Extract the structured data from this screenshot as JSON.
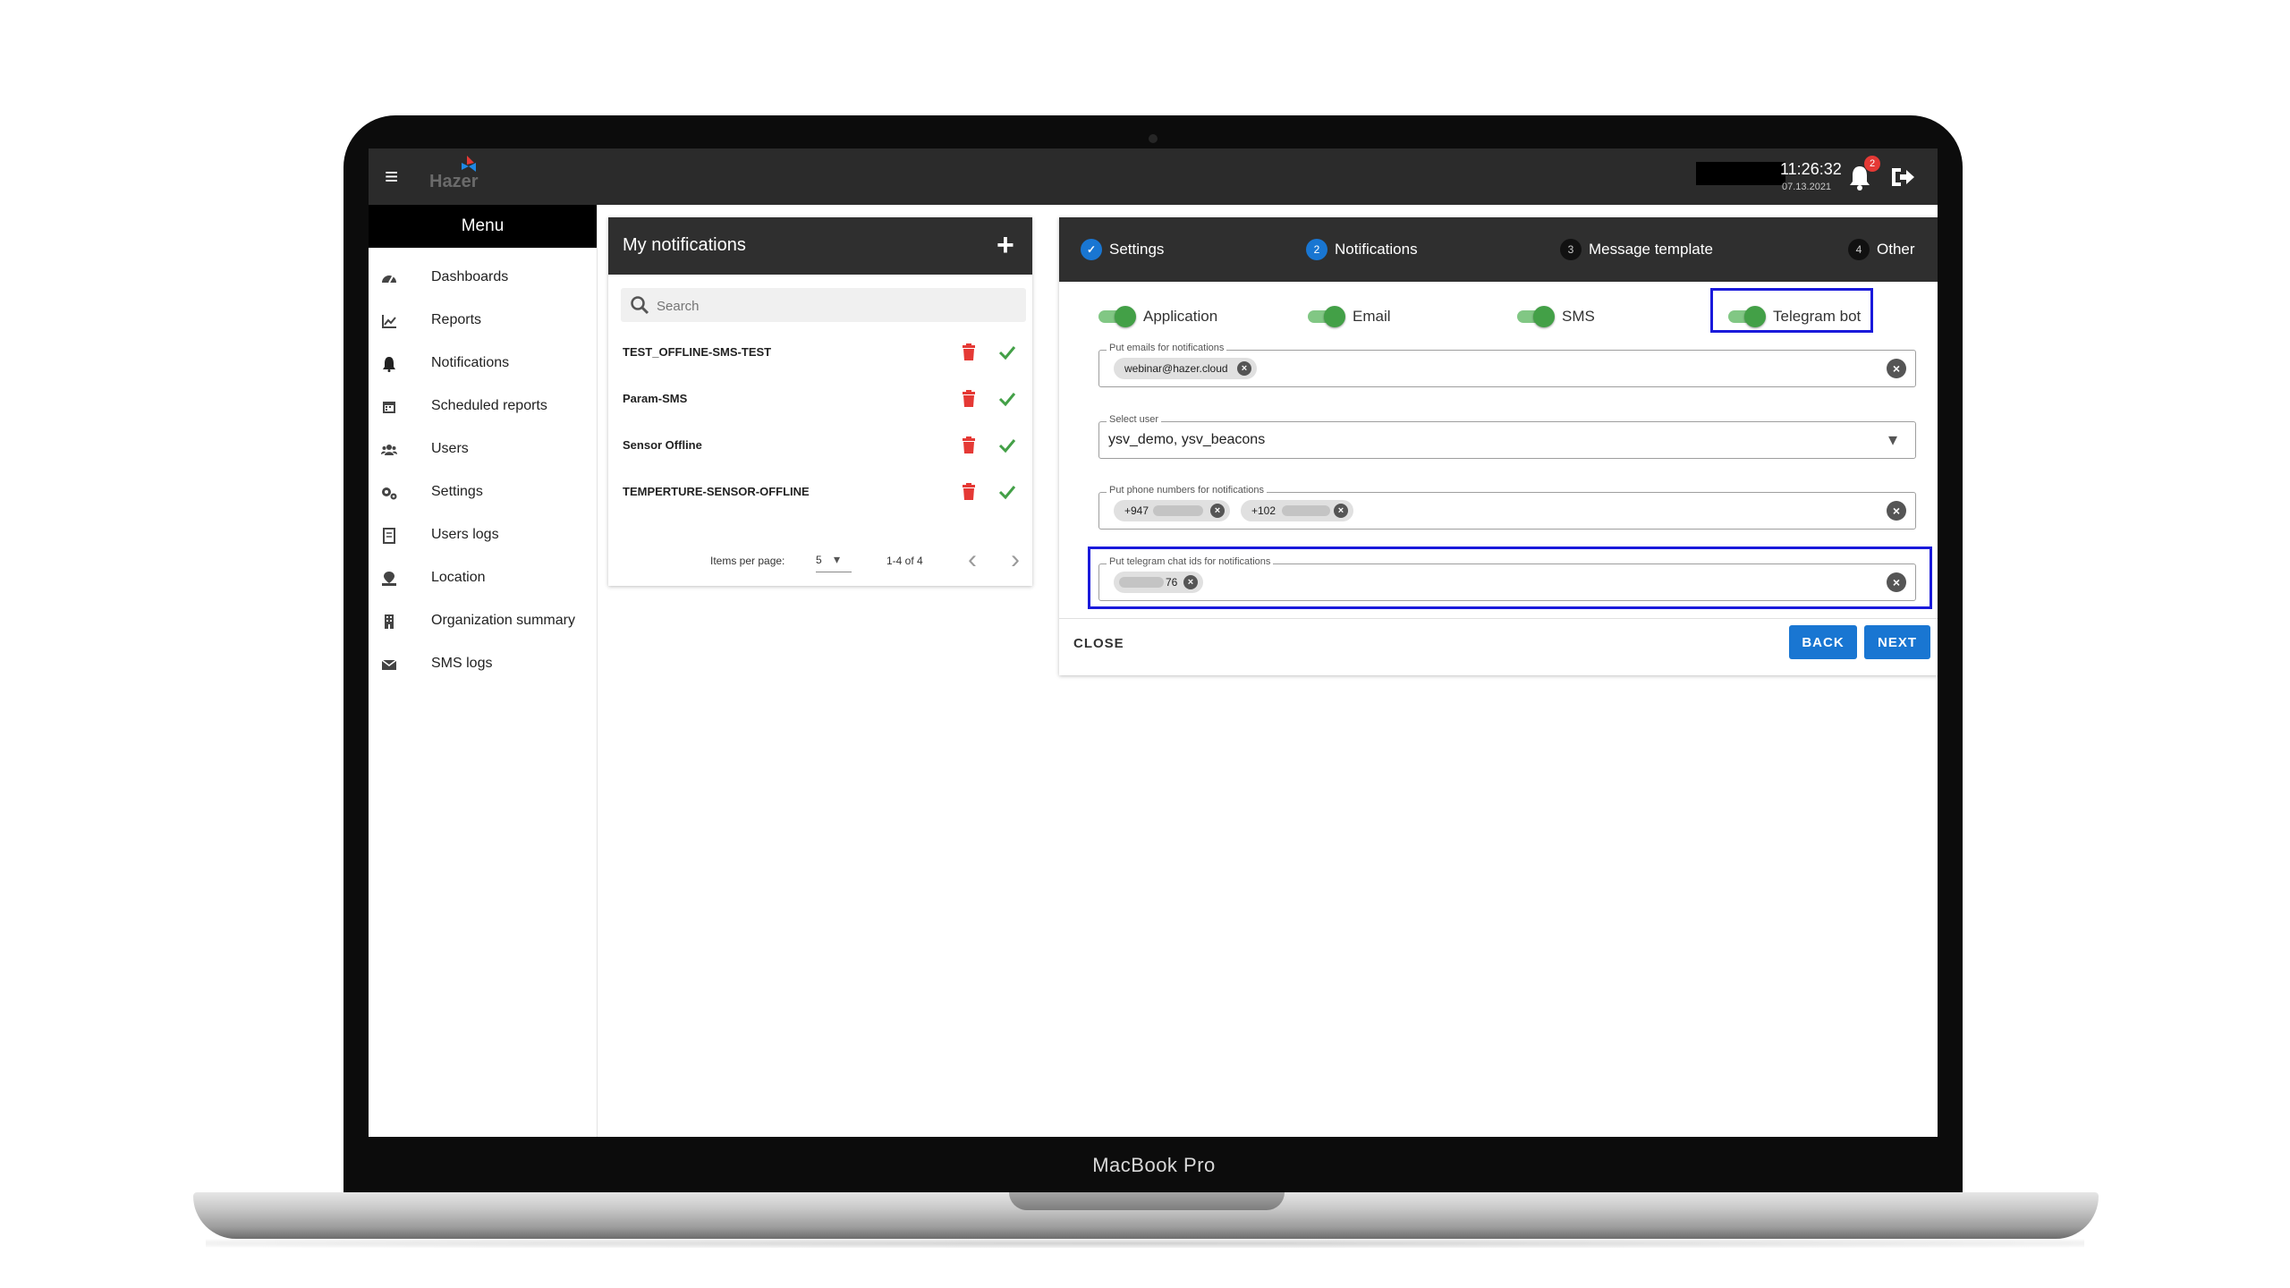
{
  "device": {
    "label": "MacBook Pro"
  },
  "topbar": {
    "menu_icon": "hamburger-icon",
    "logo_text": "Hazer",
    "time": "11:26:32",
    "date": "07.13.2021",
    "notification_count": "2",
    "accent_color": "#2b2b2b"
  },
  "sidebar": {
    "title": "Menu",
    "items": [
      {
        "label": "Dashboards",
        "icon": "speedometer-icon"
      },
      {
        "label": "Reports",
        "icon": "line-chart-icon"
      },
      {
        "label": "Notifications",
        "icon": "bell-icon"
      },
      {
        "label": "Scheduled reports",
        "icon": "calendar-icon"
      },
      {
        "label": "Users",
        "icon": "users-icon"
      },
      {
        "label": "Settings",
        "icon": "gears-icon"
      },
      {
        "label": "Users logs",
        "icon": "log-icon"
      },
      {
        "label": "Location",
        "icon": "map-pin-icon"
      },
      {
        "label": "Organization summary",
        "icon": "building-icon"
      },
      {
        "label": "SMS logs",
        "icon": "envelope-icon"
      }
    ]
  },
  "notifications_list": {
    "title": "My notifications",
    "add_icon": "plus-icon",
    "search_placeholder": "Search",
    "rows": [
      {
        "name": "TEST_OFFLINE-SMS-TEST"
      },
      {
        "name": "Param-SMS"
      },
      {
        "name": "Sensor Offline"
      },
      {
        "name": "TEMPERTURE-SENSOR-OFFLINE"
      }
    ],
    "pagination": {
      "items_per_page_label": "Items per page:",
      "items_per_page": "5",
      "range": "1-4 of 4"
    }
  },
  "stepper": {
    "steps": [
      {
        "number": "✓",
        "label": "Settings",
        "state": "done"
      },
      {
        "number": "2",
        "label": "Notifications",
        "state": "active"
      },
      {
        "number": "3",
        "label": "Message template",
        "state": "pending"
      },
      {
        "number": "4",
        "label": "Other",
        "state": "pending"
      }
    ],
    "toggles": [
      {
        "label": "Application",
        "on": true
      },
      {
        "label": "Email",
        "on": true
      },
      {
        "label": "SMS",
        "on": true
      },
      {
        "label": "Telegram bot",
        "on": true
      }
    ],
    "email_field": {
      "legend": "Put emails for notifications",
      "chips": [
        "webinar@hazer.cloud"
      ]
    },
    "user_select": {
      "legend": "Select user",
      "value": "ysv_demo, ysv_beacons"
    },
    "phone_field": {
      "legend": "Put phone numbers for notifications",
      "chips": [
        "+947",
        "+102"
      ]
    },
    "telegram_field": {
      "legend": "Put telegram chat ids for notifications",
      "chips": [
        "76"
      ]
    },
    "close_label": "CLOSE",
    "back_label": "BACK",
    "next_label": "NEXT",
    "primary_color": "#1976d2",
    "highlight_color": "#1a1adb"
  }
}
